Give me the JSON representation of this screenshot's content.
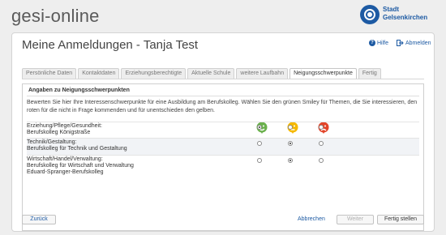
{
  "app": {
    "title": "gesi-online"
  },
  "logo": {
    "line1": "Stadt",
    "line2": "Gelsenkirchen",
    "brand_color": "#1d5aa3"
  },
  "page": {
    "title": "Meine Anmeldungen - Tanja Test"
  },
  "header_links": {
    "help": "Hilfe",
    "logout": "Abmelden"
  },
  "tabs": [
    {
      "label": "Persönliche Daten",
      "active": false
    },
    {
      "label": "Kontaktdaten",
      "active": false
    },
    {
      "label": "Erziehungsberechtigte",
      "active": false
    },
    {
      "label": "Aktuelle Schule",
      "active": false
    },
    {
      "label": "weitere Laufbahn",
      "active": false
    },
    {
      "label": "Neigungsschwerpunkte",
      "active": true
    },
    {
      "label": "Fertig",
      "active": false
    }
  ],
  "section": {
    "title": "Angaben zu Neigungsschwerpunkten",
    "description": "Bewerten Sie hier Ihre Interessenschwerpunkte für eine Ausbildung am Berufskolleg. Wählen Sie den grünen Smiley für Themen, die Sie interessieren, den roten für die nicht in Frage kommenden und für unentschieden den gelben."
  },
  "smileys": [
    {
      "icon": "green-smiley-icon",
      "color": "#6ab04c"
    },
    {
      "icon": "yellow-smiley-icon",
      "color": "#f5b800"
    },
    {
      "icon": "red-smiley-icon",
      "color": "#e2452a"
    }
  ],
  "rows": [
    {
      "lines": [
        "Erziehung/Pflege/Gesundheit:",
        "Berufskolleg Königstraße"
      ],
      "selected": 0
    },
    {
      "lines": [
        "Technik/Gestaltung:",
        "Berufskolleg für Technik und Gestaltung"
      ],
      "selected": 1
    },
    {
      "lines": [
        "Wirtschaft/Handel/Verwaltung:",
        "Berufskolleg für Wirtschaft und Verwaltung",
        "Eduard-Spranger-Berufskolleg"
      ],
      "selected": 1
    }
  ],
  "buttons": {
    "back": "Zurück",
    "cancel": "Abbrechen",
    "next": "Weiter",
    "finish": "Fertig stellen"
  }
}
